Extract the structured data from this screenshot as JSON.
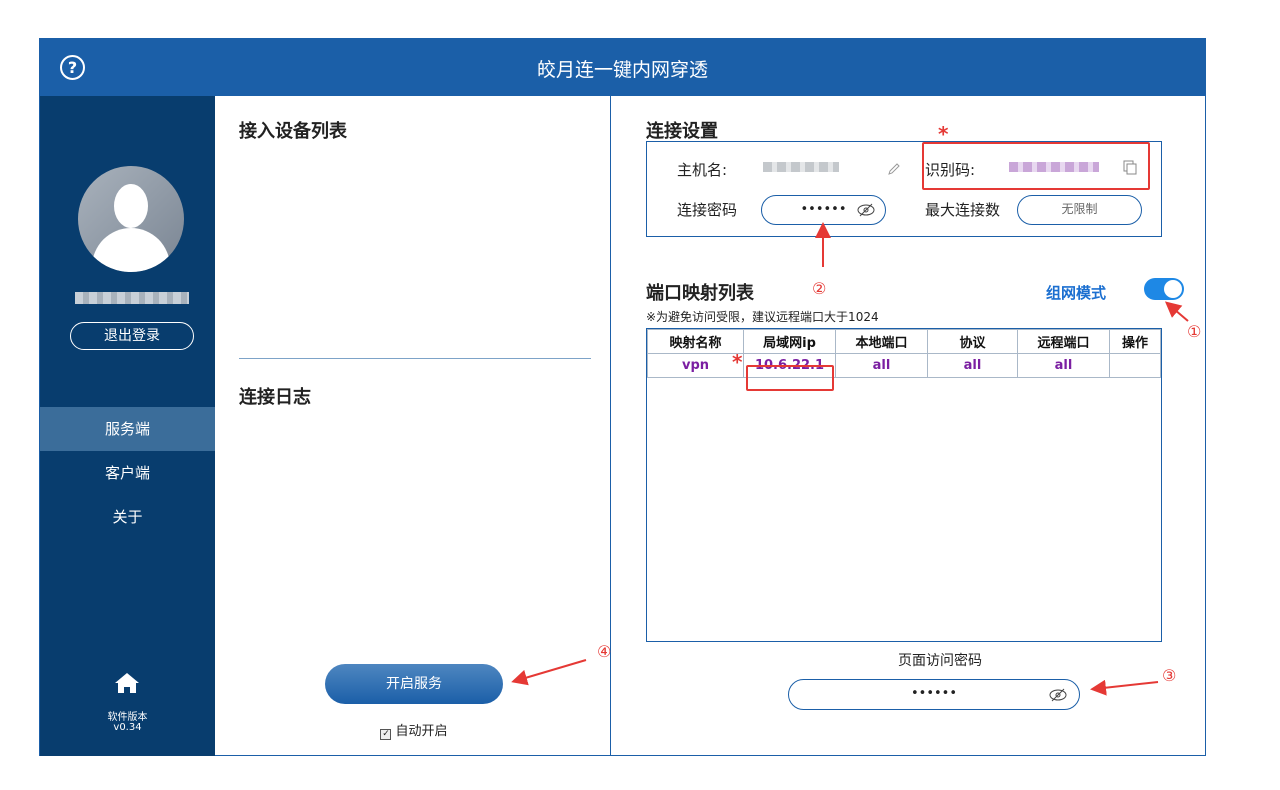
{
  "window": {
    "title": "皎月连一键内网穿透",
    "help_icon": "?"
  },
  "sidebar": {
    "logout_label": "退出登录",
    "nav": [
      {
        "label": "服务端",
        "active": true
      },
      {
        "label": "客户端",
        "active": false
      },
      {
        "label": "关于",
        "active": false
      }
    ],
    "version_label": "软件版本",
    "version": "v0.34"
  },
  "middle": {
    "devices_title": "接入设备列表",
    "log_title": "连接日志",
    "start_button": "开启服务",
    "auto_start_label": "自动开启",
    "auto_start_checked": true
  },
  "connection": {
    "title": "连接设置",
    "hostname_label": "主机名:",
    "id_label": "识别码:",
    "password_label": "连接密码",
    "password_value": "••••••",
    "max_conn_label": "最大连接数",
    "max_conn_value": "无限制"
  },
  "ports": {
    "title": "端口映射列表",
    "mode_label": "组网模式",
    "mode_on": true,
    "note": "※为避免访问受限，建议远程端口大于1024",
    "columns": [
      "映射名称",
      "局域网ip",
      "本地端口",
      "协议",
      "远程端口",
      "操作"
    ],
    "rows": [
      [
        "vpn",
        "10.6.22.1",
        "all",
        "all",
        "all",
        ""
      ]
    ]
  },
  "page_password": {
    "label": "页面访问密码",
    "value": "••••••"
  },
  "annotations": {
    "c1": "①",
    "c2": "②",
    "c3": "③",
    "c4": "④",
    "star": "*"
  },
  "colors": {
    "brand": "#1b5fa8",
    "sidebar": "#083d6e",
    "annotation": "#e53935",
    "toggle": "#1e88e5"
  }
}
